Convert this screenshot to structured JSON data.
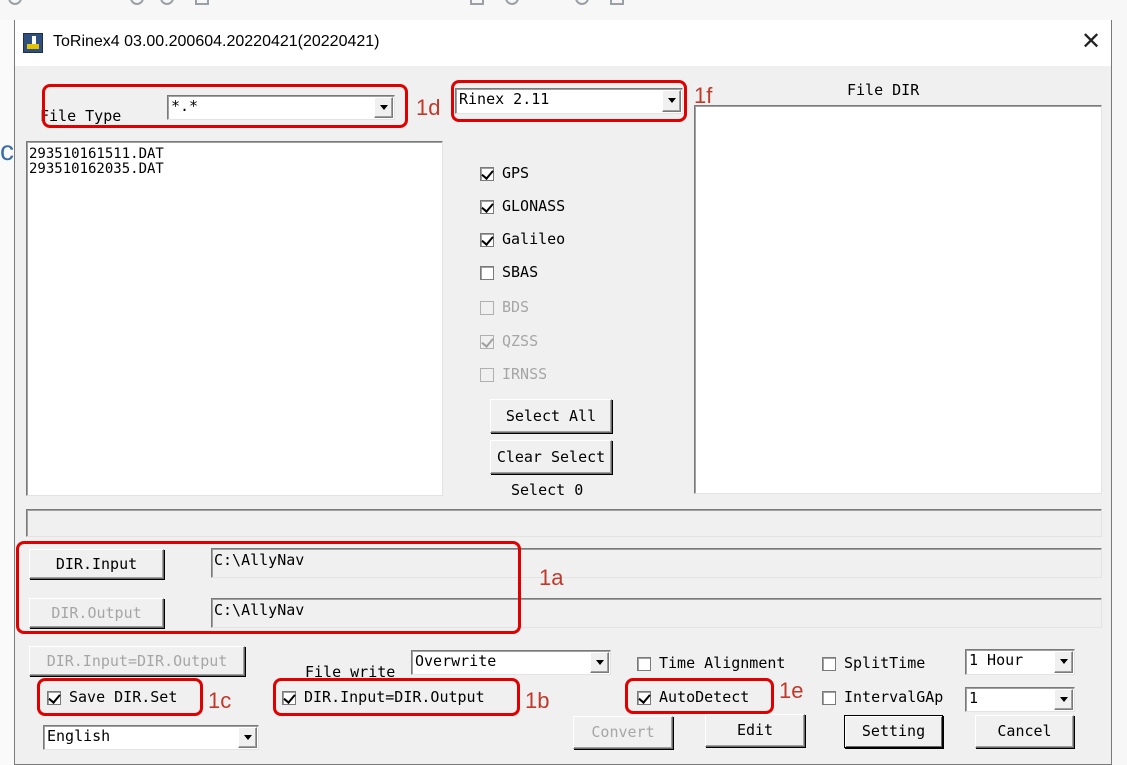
{
  "window": {
    "title": "ToRinex4 03.00.200604.20220421(20220421)",
    "close": "✕"
  },
  "left_panel": {
    "file_type_label": "File Type",
    "file_type_value": "*.*",
    "files": [
      "293510161511.DAT",
      "293510162035.DAT"
    ]
  },
  "rinex": {
    "version": "Rinex 2.11"
  },
  "systems": [
    {
      "label": "GPS",
      "checked": true,
      "enabled": true
    },
    {
      "label": "GLONASS",
      "checked": true,
      "enabled": true
    },
    {
      "label": "Galileo",
      "checked": true,
      "enabled": true
    },
    {
      "label": "SBAS",
      "checked": false,
      "enabled": true
    },
    {
      "label": "BDS",
      "checked": false,
      "enabled": false
    },
    {
      "label": "QZSS",
      "checked": true,
      "enabled": false
    },
    {
      "label": "IRNSS",
      "checked": false,
      "enabled": false
    }
  ],
  "selection": {
    "select_all": "Select All",
    "clear_select": "Clear Select",
    "status": "Select 0"
  },
  "file_dir": {
    "label": "File DIR"
  },
  "dirs": {
    "input_button": "DIR.Input",
    "input_path": "C:\\AllyNav",
    "output_button": "DIR.Output",
    "output_path": "C:\\AllyNav",
    "same_button": "DIR.Input=DIR.Output"
  },
  "options": {
    "file_write_label": "File write",
    "file_write_value": "Overwrite",
    "time_alignment": "Time Alignment",
    "split_time": "SplitTime",
    "split_value": "1 Hour",
    "save_dir_set": "Save DIR.Set",
    "dir_same_check": "DIR.Input=DIR.Output",
    "auto_detect": "AutoDetect",
    "interval_gap": "IntervalGAp",
    "interval_value": "1",
    "language": "English"
  },
  "actions": {
    "convert": "Convert",
    "edit": "Edit",
    "setting": "Setting",
    "cancel": "Cancel"
  },
  "annotations": {
    "a": "1a",
    "b": "1b",
    "c": "1c",
    "d": "1d",
    "e": "1e",
    "f": "1f"
  },
  "colors": {
    "annotation_box": "#e00000",
    "annotation_text": "#c0392b",
    "dialog_bg": "#f0f0f0"
  }
}
